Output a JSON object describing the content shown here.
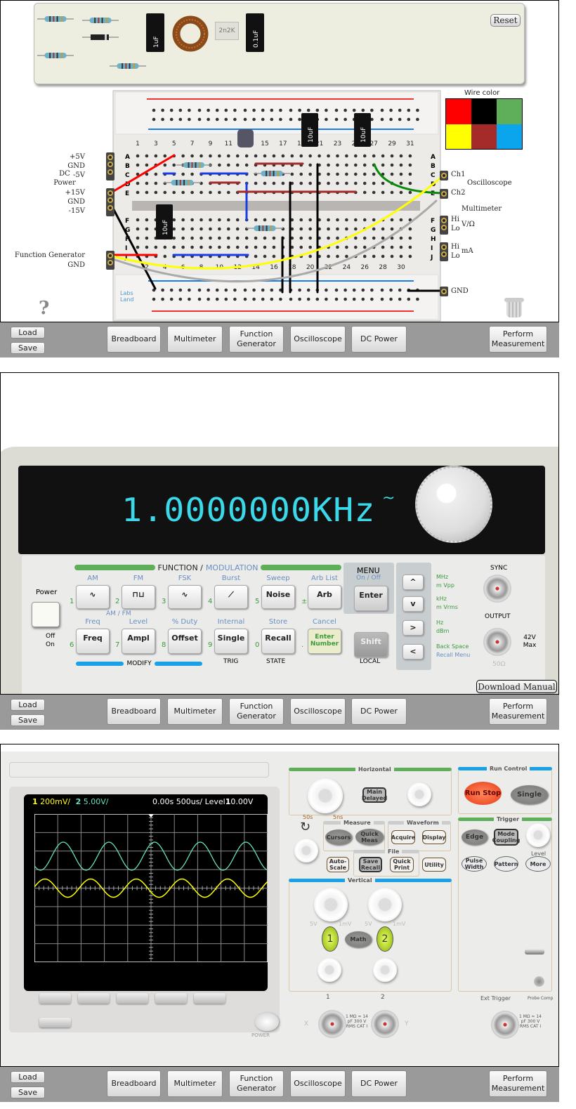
{
  "toolbar": {
    "load": "Load",
    "save": "Save",
    "breadboard": "Breadboard",
    "multimeter": "Multimeter",
    "function_generator": "Function Generator",
    "oscilloscope": "Oscilloscope",
    "dc_power": "DC Power",
    "perform_measurement": "Perform Measurement"
  },
  "breadboard": {
    "reset": "Reset",
    "components": {
      "ceramic": "2n2K",
      "cap1": "1uF",
      "cap2": "0.1uF"
    },
    "board_caps": [
      "10uF",
      "10uF",
      "10uF"
    ],
    "wire_color_title": "Wire color",
    "wire_colors": [
      "#ff0000",
      "#000000",
      "#5fae5a",
      "#ffff00",
      "#a52a2a",
      "#0aa5ec"
    ],
    "dc_power": {
      "title": "DC Power",
      "pins": [
        "+5V",
        "GND",
        "-5V",
        "+15V",
        "GND",
        "-15V"
      ]
    },
    "function_generator": {
      "title": "Function Generator",
      "pins": [
        "GND"
      ]
    },
    "oscilloscope": {
      "title": "Oscilloscope",
      "ch1": "Ch1",
      "ch2": "Ch2"
    },
    "multimeter": {
      "title": "Multimeter",
      "hi1": "Hi",
      "lo1": "Lo",
      "v_ohm": "V/Ω",
      "hi2": "Hi",
      "lo2": "Lo",
      "ma": "mA"
    },
    "gnd": "GND",
    "rows_top": [
      "A",
      "B",
      "C",
      "D",
      "E"
    ],
    "rows_bottom": [
      "F",
      "G",
      "H",
      "I",
      "J"
    ],
    "logo": "Labs Land",
    "help": "?"
  },
  "function_generator": {
    "display": "1.0000000KHz",
    "wave_symbol": "~",
    "header_function": "FUNCTION /",
    "header_modulation": "MODULATION",
    "power": "Power",
    "off": "Off",
    "on": "On",
    "top_labels": [
      "AM",
      "FM",
      "FSK",
      "Burst",
      "Sweep",
      "Arb List"
    ],
    "top_buttons": [
      "∿",
      "⊓⊔",
      "∿",
      "⟋",
      "Noise",
      "Arb"
    ],
    "top_nums": [
      "1",
      "2",
      "3",
      "4",
      "5",
      "±"
    ],
    "amfm": "AM / FM",
    "bottom_labels": [
      "Freq",
      "Level",
      "% Duty",
      "Internal",
      "Store",
      "Cancel"
    ],
    "bottom_buttons": [
      "Freq",
      "Ampl",
      "Offset",
      "Single",
      "Recall",
      "Enter Number"
    ],
    "bottom_nums": [
      "6",
      "7",
      "8",
      "9",
      "0",
      "."
    ],
    "modify": "MODIFY",
    "trig": "TRIG",
    "state": "STATE",
    "menu": "MENU",
    "menu_sub": "On / Off",
    "enter": "Enter",
    "shift": "Shift",
    "local": "LOCAL",
    "arrows": [
      "^",
      "v",
      ">",
      "<"
    ],
    "units": [
      [
        "MHz",
        "m Vpp"
      ],
      [
        "kHz",
        "m Vrms"
      ],
      [
        "Hz",
        "dBm"
      ],
      [
        "Back Space",
        "Recall Menu"
      ]
    ],
    "sync": "SYNC",
    "output": "OUTPUT",
    "max": "42V Max",
    "ohm": "50Ω",
    "download": "Download Manual"
  },
  "oscilloscope": {
    "ch1_label": "1",
    "ch1_scale": "200mV/",
    "ch2_label": "2",
    "ch2_scale": "5.00V/",
    "time": "0.00s",
    "timebase": "500us/",
    "level_label": "Level",
    "trig_src": "1",
    "level": "0.00V",
    "ch1_color": "#ffff00",
    "ch2_color": "#66e0c0",
    "horizontal": "Horizontal",
    "h_min": "50s",
    "h_max": "5ns",
    "main_delayed": "Main Delayed",
    "run_control": "Run Control",
    "run_stop": "Run Stop",
    "single": "Single",
    "measure": "Measure",
    "cursors": "Cursors",
    "quick_meas": "Quick Meas",
    "waveform": "Waveform",
    "acquire": "Acquire",
    "display": "Display",
    "file": "File",
    "auto_scale": "Auto-Scale",
    "save_recall": "Save Recall",
    "quick_print": "Quick Print",
    "utility": "Utility",
    "trigger": "Trigger",
    "edge": "Edge",
    "mode_coupling": "Mode Coupling",
    "level_knob": "Level",
    "pulse_width": "Pulse Width",
    "pattern": "Pattern",
    "more": "More",
    "vertical": "Vertical",
    "v_min": "5V",
    "v_max": "1mV",
    "ch1_btn": "1",
    "math": "Math",
    "ch2_btn": "2",
    "in1": "1",
    "in2": "2",
    "x": "X",
    "y": "Y",
    "spec": "1 MΩ ≈ 14 pF 300 V RMS CAT I",
    "ext_trigger": "Ext Trigger",
    "probe_comp": "Probe Comp",
    "power": "POWER"
  }
}
